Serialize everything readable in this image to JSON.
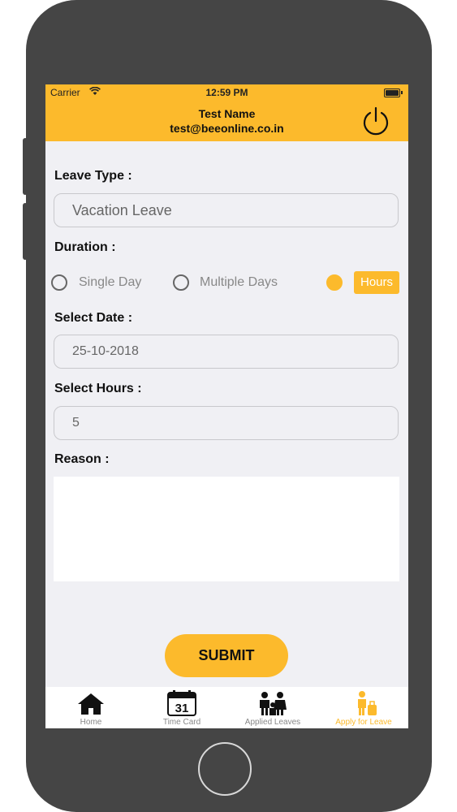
{
  "status_bar": {
    "carrier": "Carrier",
    "time": "12:59 PM"
  },
  "header": {
    "name": "Test Name",
    "email": "test@beeonline.co.in"
  },
  "form": {
    "leave_type_label": "Leave Type :",
    "leave_type_value": "Vacation Leave",
    "duration_label": "Duration :",
    "duration_options": [
      "Single Day",
      "Multiple Days",
      "Hours"
    ],
    "duration_selected": "Hours",
    "date_label": "Select Date :",
    "date_value": "25-10-2018",
    "hours_label": "Select Hours :",
    "hours_value": "5",
    "reason_label": "Reason :",
    "reason_value": "",
    "submit_label": "SUBMIT"
  },
  "tabs": [
    {
      "label": "Home",
      "icon": "home-icon"
    },
    {
      "label": "Time Card",
      "icon": "calendar-icon",
      "icon_text": "31"
    },
    {
      "label": "Applied Leaves",
      "icon": "family-icon"
    },
    {
      "label": "Apply for Leave",
      "icon": "traveler-icon",
      "active": true
    }
  ],
  "colors": {
    "accent": "#fcba2c",
    "phone_body": "#454545",
    "screen_bg": "#f0f0f4"
  }
}
